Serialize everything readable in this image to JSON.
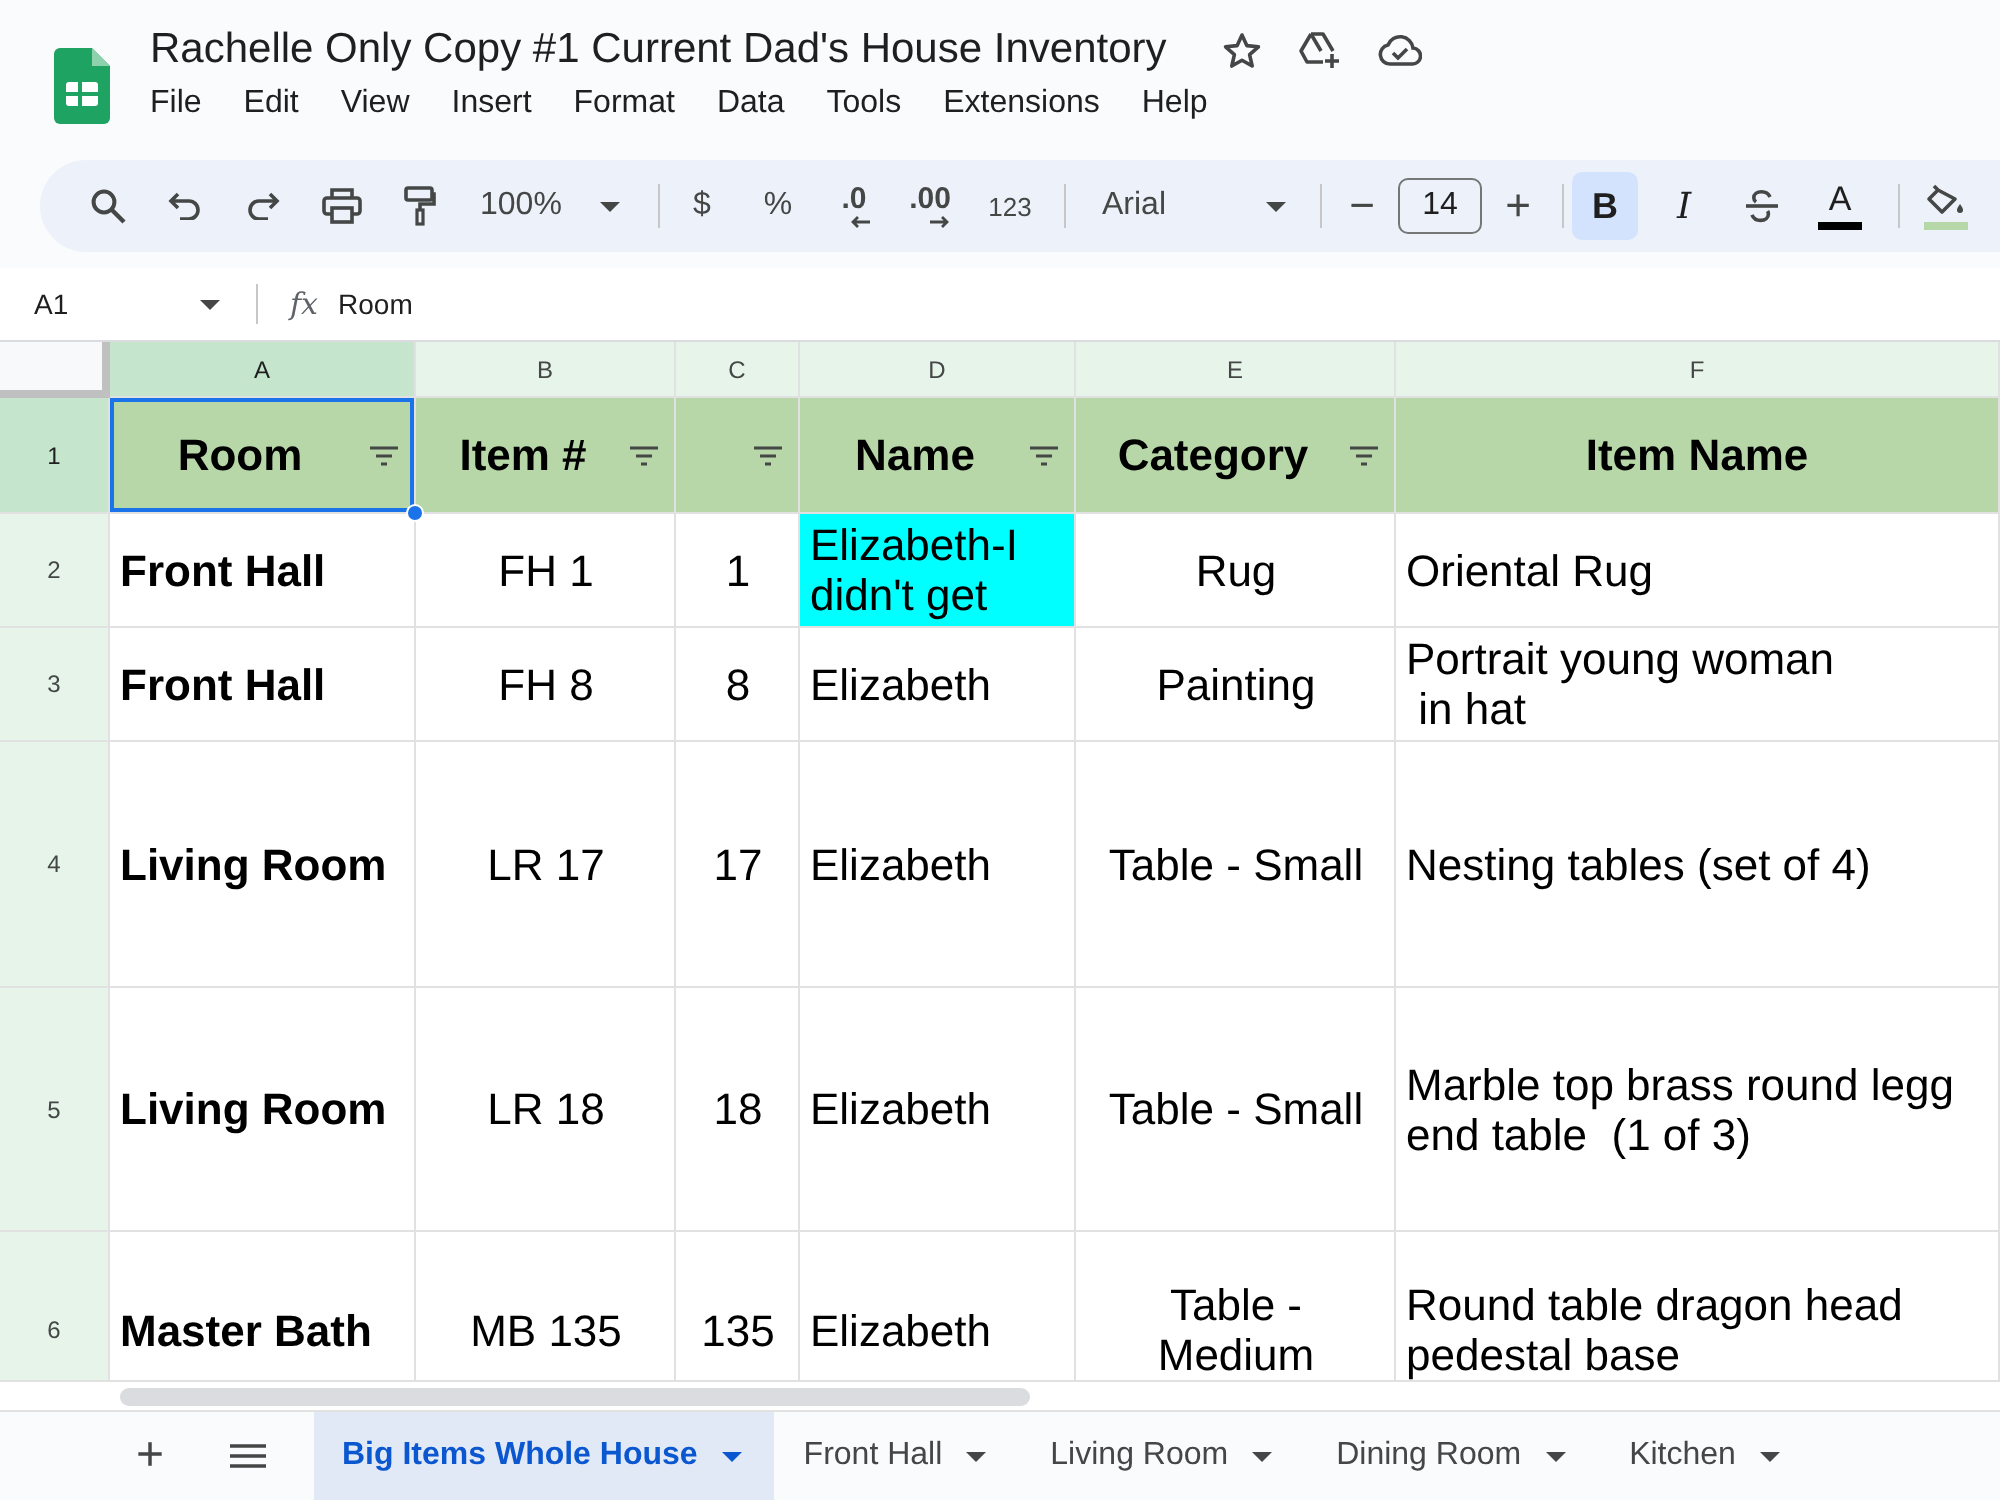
{
  "app": {
    "title": "Rachelle Only Copy #1 Current Dad's House Inventory",
    "menu": [
      "File",
      "Edit",
      "View",
      "Insert",
      "Format",
      "Data",
      "Tools",
      "Extensions",
      "Help"
    ]
  },
  "toolbar": {
    "zoom": "100%",
    "number_formats": [
      {
        "label": "$",
        "kind": "plain"
      },
      {
        "label": "%",
        "kind": "plain"
      },
      {
        "label": ".0",
        "kind": "decrease"
      },
      {
        "label": ".00",
        "kind": "increase"
      },
      {
        "label": "123",
        "kind": "small"
      }
    ],
    "font": "Arial",
    "size_down": "−",
    "font_size": "14",
    "size_up": "+",
    "styles": [
      {
        "label": "B",
        "kind": "bold",
        "selected": true
      },
      {
        "label": "I",
        "kind": "italic",
        "selected": false
      }
    ],
    "color_buttons": [
      {
        "kind": "text",
        "label": "A",
        "color": "#000000"
      },
      {
        "kind": "fill",
        "color": "#b6d7a8"
      }
    ]
  },
  "formula_bar": {
    "cell": "A1",
    "function_label": "fx",
    "value": "Room"
  },
  "sheet": {
    "columns": [
      {
        "letter": "A",
        "selected": true
      },
      {
        "letter": "B",
        "selected": false
      },
      {
        "letter": "C",
        "selected": false
      },
      {
        "letter": "D",
        "selected": false
      },
      {
        "letter": "E",
        "selected": false
      },
      {
        "letter": "F",
        "selected": false
      }
    ],
    "rows": [
      {
        "number": "1",
        "selected": true,
        "kind": "header",
        "cells": [
          {
            "text": "Room",
            "filter": true,
            "selected": true
          },
          {
            "text": "Item #",
            "filter": true,
            "selected": false
          },
          {
            "filter": true,
            "selected": false
          },
          {
            "text": "Name",
            "filter": true,
            "selected": false
          },
          {
            "text": "Category",
            "filter": true,
            "selected": false
          },
          {
            "text": "Item Name",
            "filter": false,
            "selected": false
          }
        ]
      },
      {
        "number": "2",
        "selected": false,
        "kind": "data",
        "cells": [
          {
            "text": "Front Hall",
            "selected": false
          },
          {
            "text": "FH 1",
            "selected": false
          },
          {
            "text": "1",
            "selected": false
          },
          {
            "text": "Elizabeth-I didn't get",
            "selected": false,
            "color": "#00ffff"
          },
          {
            "text": "Rug",
            "selected": false
          },
          {
            "text": "Oriental Rug",
            "selected": false
          }
        ]
      },
      {
        "number": "3",
        "selected": false,
        "kind": "data",
        "cells": [
          {
            "text": "Front Hall",
            "selected": false
          },
          {
            "text": "FH 8",
            "selected": false
          },
          {
            "text": "8",
            "selected": false
          },
          {
            "text": "Elizabeth",
            "selected": false
          },
          {
            "text": "Painting",
            "selected": false
          },
          {
            "text": "Portrait young woman\n in hat",
            "selected": false
          }
        ]
      },
      {
        "number": "4",
        "selected": false,
        "kind": "data",
        "cells": [
          {
            "text": "Living Room",
            "selected": false
          },
          {
            "text": "LR 17",
            "selected": false
          },
          {
            "text": "17",
            "selected": false
          },
          {
            "text": "Elizabeth",
            "selected": false
          },
          {
            "text": "Table - Small",
            "selected": false
          },
          {
            "text": "Nesting tables (set of 4)",
            "selected": false
          }
        ]
      },
      {
        "number": "5",
        "selected": false,
        "kind": "data",
        "cells": [
          {
            "text": "Living Room",
            "selected": false
          },
          {
            "text": "LR 18",
            "selected": false
          },
          {
            "text": "18",
            "selected": false
          },
          {
            "text": "Elizabeth",
            "selected": false
          },
          {
            "text": "Table - Small",
            "selected": false
          },
          {
            "text": "Marble top brass round legg\nend table  (1 of 3)",
            "selected": false
          }
        ]
      },
      {
        "number": "6",
        "selected": false,
        "kind": "data",
        "cells": [
          {
            "text": "Master Bath",
            "selected": false
          },
          {
            "text": "MB 135",
            "selected": false
          },
          {
            "text": "135",
            "selected": false
          },
          {
            "text": "Elizabeth",
            "selected": false
          },
          {
            "text": "Table - Medium",
            "selected": false
          },
          {
            "text": "Round table dragon head pedestal base",
            "selected": false
          }
        ]
      }
    ]
  },
  "sheet_tabs": {
    "add": "+",
    "tabs": [
      {
        "label": "Big Items Whole House",
        "selected": true
      },
      {
        "label": "Front Hall",
        "selected": false
      },
      {
        "label": "Living Room",
        "selected": false
      },
      {
        "label": "Dining Room",
        "selected": false
      },
      {
        "label": "Kitchen",
        "selected": false
      }
    ]
  }
}
